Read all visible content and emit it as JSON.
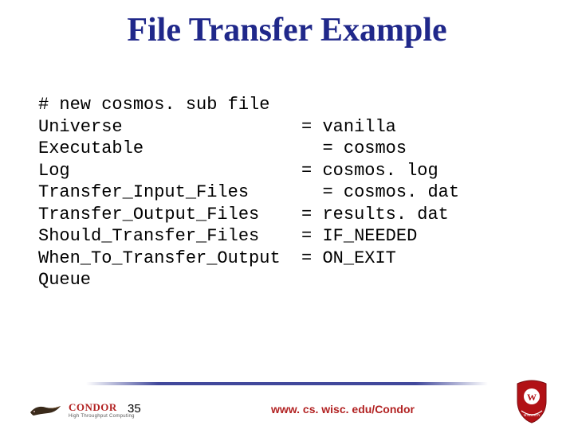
{
  "title": "File Transfer Example",
  "code": {
    "l1": "# new cosmos. sub file",
    "l2": "Universe                 = vanilla",
    "l3": "Executable                 = cosmos",
    "l4": "Log                      = cosmos. log",
    "l5": "Transfer_Input_Files       = cosmos. dat",
    "l6": "Transfer_Output_Files    = results. dat",
    "l7": "Should_Transfer_Files    = IF_NEEDED",
    "l8": "When_To_Transfer_Output  = ON_EXIT",
    "l9": "Queue"
  },
  "footer": {
    "page_number": "35",
    "url": "www. cs. wisc. edu/Condor",
    "brand": "CONDOR",
    "brand_sub": "High Throughput Computing"
  }
}
